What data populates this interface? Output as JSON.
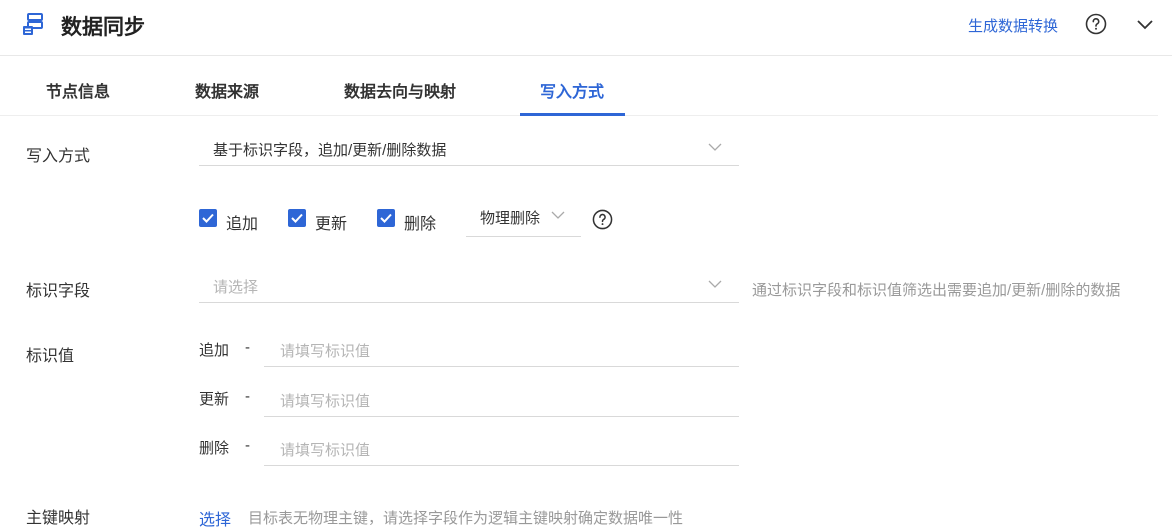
{
  "header": {
    "title": "数据同步",
    "generate_link": "生成数据转换",
    "app_icon": "data-sync-icon",
    "help_icon": "question-circle-icon",
    "collapse_icon": "chevron-down-icon"
  },
  "tabs": [
    {
      "label": "节点信息"
    },
    {
      "label": "数据来源"
    },
    {
      "label": "数据去向与映射"
    },
    {
      "label": "写入方式",
      "active": true
    }
  ],
  "form": {
    "write_mode": {
      "label": "写入方式",
      "value": "基于标识字段，追加/更新/删除数据"
    },
    "operations": {
      "add": {
        "label": "追加",
        "checked": true
      },
      "update": {
        "label": "更新",
        "checked": true
      },
      "delete": {
        "label": "删除",
        "checked": true
      },
      "delete_mode": "物理删除",
      "help_icon": "question-circle-icon"
    },
    "id_field": {
      "label": "标识字段",
      "placeholder": "请选择",
      "hint": "通过标识字段和标识值筛选出需要追加/更新/删除的数据"
    },
    "id_value": {
      "label": "标识值",
      "dash": "-",
      "rows": [
        {
          "label": "追加",
          "placeholder": "请填写标识值"
        },
        {
          "label": "更新",
          "placeholder": "请填写标识值"
        },
        {
          "label": "删除",
          "placeholder": "请填写标识值"
        }
      ]
    },
    "pk_mapping": {
      "label": "主键映射",
      "link": "选择",
      "hint": "目标表无物理主键，请选择字段作为逻辑主键映射确定数据唯一性"
    }
  },
  "colors": {
    "accent": "#2e66d6",
    "text": "#333333",
    "muted": "#999999",
    "placeholder": "#b5b5b5"
  }
}
